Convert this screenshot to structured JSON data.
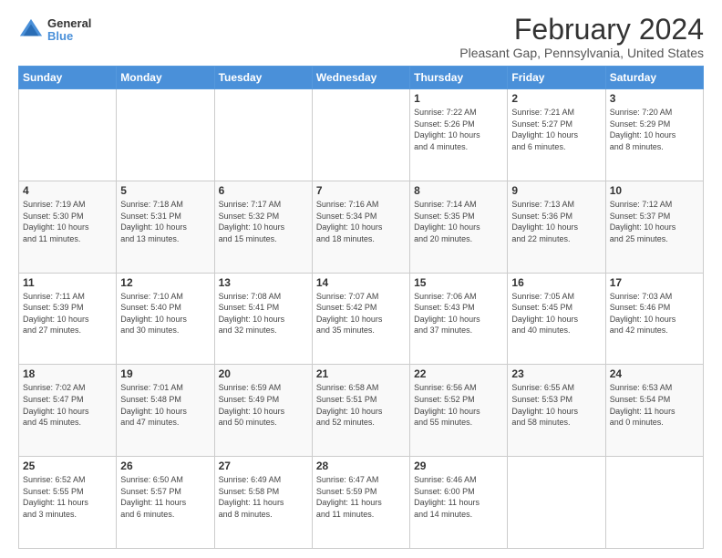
{
  "header": {
    "logo_general": "General",
    "logo_blue": "Blue",
    "main_title": "February 2024",
    "subtitle": "Pleasant Gap, Pennsylvania, United States"
  },
  "weekdays": [
    "Sunday",
    "Monday",
    "Tuesday",
    "Wednesday",
    "Thursday",
    "Friday",
    "Saturday"
  ],
  "weeks": [
    [
      {
        "day": "",
        "info": ""
      },
      {
        "day": "",
        "info": ""
      },
      {
        "day": "",
        "info": ""
      },
      {
        "day": "",
        "info": ""
      },
      {
        "day": "1",
        "info": "Sunrise: 7:22 AM\nSunset: 5:26 PM\nDaylight: 10 hours\nand 4 minutes."
      },
      {
        "day": "2",
        "info": "Sunrise: 7:21 AM\nSunset: 5:27 PM\nDaylight: 10 hours\nand 6 minutes."
      },
      {
        "day": "3",
        "info": "Sunrise: 7:20 AM\nSunset: 5:29 PM\nDaylight: 10 hours\nand 8 minutes."
      }
    ],
    [
      {
        "day": "4",
        "info": "Sunrise: 7:19 AM\nSunset: 5:30 PM\nDaylight: 10 hours\nand 11 minutes."
      },
      {
        "day": "5",
        "info": "Sunrise: 7:18 AM\nSunset: 5:31 PM\nDaylight: 10 hours\nand 13 minutes."
      },
      {
        "day": "6",
        "info": "Sunrise: 7:17 AM\nSunset: 5:32 PM\nDaylight: 10 hours\nand 15 minutes."
      },
      {
        "day": "7",
        "info": "Sunrise: 7:16 AM\nSunset: 5:34 PM\nDaylight: 10 hours\nand 18 minutes."
      },
      {
        "day": "8",
        "info": "Sunrise: 7:14 AM\nSunset: 5:35 PM\nDaylight: 10 hours\nand 20 minutes."
      },
      {
        "day": "9",
        "info": "Sunrise: 7:13 AM\nSunset: 5:36 PM\nDaylight: 10 hours\nand 22 minutes."
      },
      {
        "day": "10",
        "info": "Sunrise: 7:12 AM\nSunset: 5:37 PM\nDaylight: 10 hours\nand 25 minutes."
      }
    ],
    [
      {
        "day": "11",
        "info": "Sunrise: 7:11 AM\nSunset: 5:39 PM\nDaylight: 10 hours\nand 27 minutes."
      },
      {
        "day": "12",
        "info": "Sunrise: 7:10 AM\nSunset: 5:40 PM\nDaylight: 10 hours\nand 30 minutes."
      },
      {
        "day": "13",
        "info": "Sunrise: 7:08 AM\nSunset: 5:41 PM\nDaylight: 10 hours\nand 32 minutes."
      },
      {
        "day": "14",
        "info": "Sunrise: 7:07 AM\nSunset: 5:42 PM\nDaylight: 10 hours\nand 35 minutes."
      },
      {
        "day": "15",
        "info": "Sunrise: 7:06 AM\nSunset: 5:43 PM\nDaylight: 10 hours\nand 37 minutes."
      },
      {
        "day": "16",
        "info": "Sunrise: 7:05 AM\nSunset: 5:45 PM\nDaylight: 10 hours\nand 40 minutes."
      },
      {
        "day": "17",
        "info": "Sunrise: 7:03 AM\nSunset: 5:46 PM\nDaylight: 10 hours\nand 42 minutes."
      }
    ],
    [
      {
        "day": "18",
        "info": "Sunrise: 7:02 AM\nSunset: 5:47 PM\nDaylight: 10 hours\nand 45 minutes."
      },
      {
        "day": "19",
        "info": "Sunrise: 7:01 AM\nSunset: 5:48 PM\nDaylight: 10 hours\nand 47 minutes."
      },
      {
        "day": "20",
        "info": "Sunrise: 6:59 AM\nSunset: 5:49 PM\nDaylight: 10 hours\nand 50 minutes."
      },
      {
        "day": "21",
        "info": "Sunrise: 6:58 AM\nSunset: 5:51 PM\nDaylight: 10 hours\nand 52 minutes."
      },
      {
        "day": "22",
        "info": "Sunrise: 6:56 AM\nSunset: 5:52 PM\nDaylight: 10 hours\nand 55 minutes."
      },
      {
        "day": "23",
        "info": "Sunrise: 6:55 AM\nSunset: 5:53 PM\nDaylight: 10 hours\nand 58 minutes."
      },
      {
        "day": "24",
        "info": "Sunrise: 6:53 AM\nSunset: 5:54 PM\nDaylight: 11 hours\nand 0 minutes."
      }
    ],
    [
      {
        "day": "25",
        "info": "Sunrise: 6:52 AM\nSunset: 5:55 PM\nDaylight: 11 hours\nand 3 minutes."
      },
      {
        "day": "26",
        "info": "Sunrise: 6:50 AM\nSunset: 5:57 PM\nDaylight: 11 hours\nand 6 minutes."
      },
      {
        "day": "27",
        "info": "Sunrise: 6:49 AM\nSunset: 5:58 PM\nDaylight: 11 hours\nand 8 minutes."
      },
      {
        "day": "28",
        "info": "Sunrise: 6:47 AM\nSunset: 5:59 PM\nDaylight: 11 hours\nand 11 minutes."
      },
      {
        "day": "29",
        "info": "Sunrise: 6:46 AM\nSunset: 6:00 PM\nDaylight: 11 hours\nand 14 minutes."
      },
      {
        "day": "",
        "info": ""
      },
      {
        "day": "",
        "info": ""
      }
    ]
  ]
}
